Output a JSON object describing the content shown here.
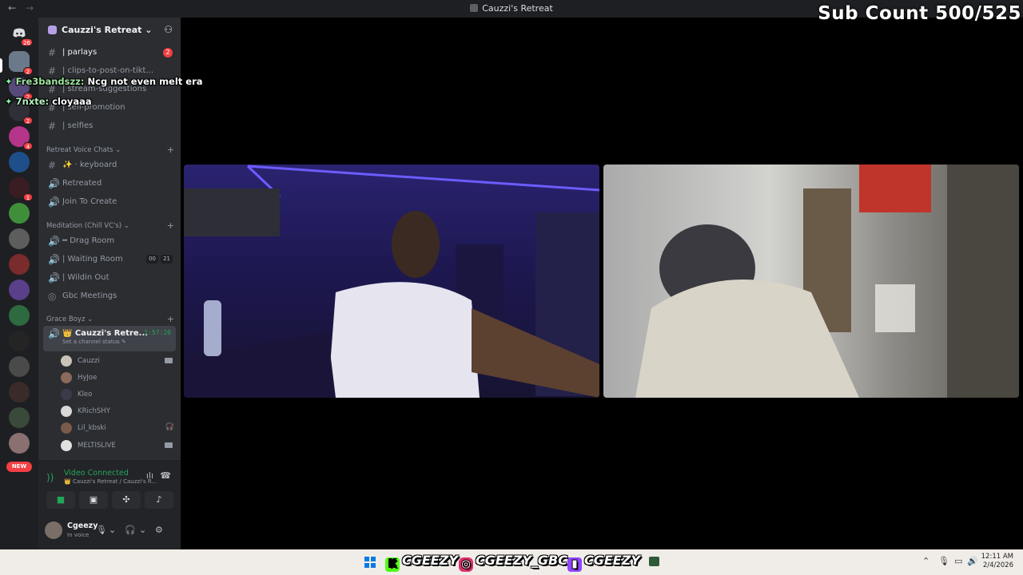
{
  "window": {
    "title": "Cauzzi's Retreat",
    "back": "←",
    "forward": "→"
  },
  "overlay": {
    "sub_count": "Sub Count 500/525"
  },
  "chat": [
    {
      "user": "Fre3bandszz:",
      "message": "Ncg not even melt era"
    },
    {
      "user": "7nxte:",
      "message": "cloyaaa"
    }
  ],
  "guilds": {
    "badges": [
      "26",
      "2",
      "2",
      "2",
      "4",
      "1"
    ],
    "new_label": "NEW"
  },
  "server": {
    "name": "Cauzzi's Retreat ⌄",
    "invite_icon": "add-user-icon"
  },
  "channels": [
    {
      "name": "| parlays",
      "mention": "2"
    },
    {
      "name": "| clips-to-post-on-tikt..."
    },
    {
      "name": "| stream-suggestions"
    },
    {
      "name": "| self-promotion"
    },
    {
      "name": "| selfies"
    }
  ],
  "categories": {
    "voice_chats": "Retreat Voice Chats ⌄",
    "meditation": "Meditation (Chill VC's) ⌄",
    "grace": "Grace Boyz ⌄"
  },
  "voice_channels_a": [
    {
      "name": "✨ · keyboard"
    },
    {
      "name": "Retreated"
    },
    {
      "name": "Join To Create"
    }
  ],
  "voice_channels_b": [
    {
      "name": "━ Drag Room"
    },
    {
      "name": "| Waiting Room",
      "count_a": "00",
      "count_b": "21"
    },
    {
      "name": "| Wildin Out"
    },
    {
      "name": "Gbc Meetings"
    }
  ],
  "active_channel": {
    "name": "👑 Cauzzi's Retre...",
    "time": "1:57:20",
    "status": "Set a channel status ✎"
  },
  "members": [
    {
      "name": "Cauzzi",
      "cam": true
    },
    {
      "name": "HyJoe"
    },
    {
      "name": "Kleo"
    },
    {
      "name": "KRichSHY"
    },
    {
      "name": "Lil_kbski",
      "deaf": true
    },
    {
      "name": "MELTISLIVE",
      "cam": true
    }
  ],
  "voice": {
    "status": "Video Connected",
    "where": "👑 Cauzzi's Retreat / Cauzzi's R...",
    "buttons": [
      "camera-icon",
      "screen-share-icon",
      "activities-icon",
      "soundboard-icon"
    ]
  },
  "user": {
    "name": "Cgeezy",
    "status": "In voice"
  },
  "taskbar": {
    "socials": [
      {
        "platform": "kick",
        "handle": "CGEEZY",
        "color": "#53fc18"
      },
      {
        "platform": "instagram",
        "handle": "CGEEZY_GBC",
        "color": "#e1306c"
      },
      {
        "platform": "twitch",
        "handle": "CGEEZY",
        "color": "#9146ff"
      }
    ],
    "time": "12:11 AM",
    "date": "2/4/2026"
  },
  "colors": {
    "accent_green": "#23a559",
    "mention_red": "#f23f43",
    "sidebar": "#2b2d31"
  }
}
